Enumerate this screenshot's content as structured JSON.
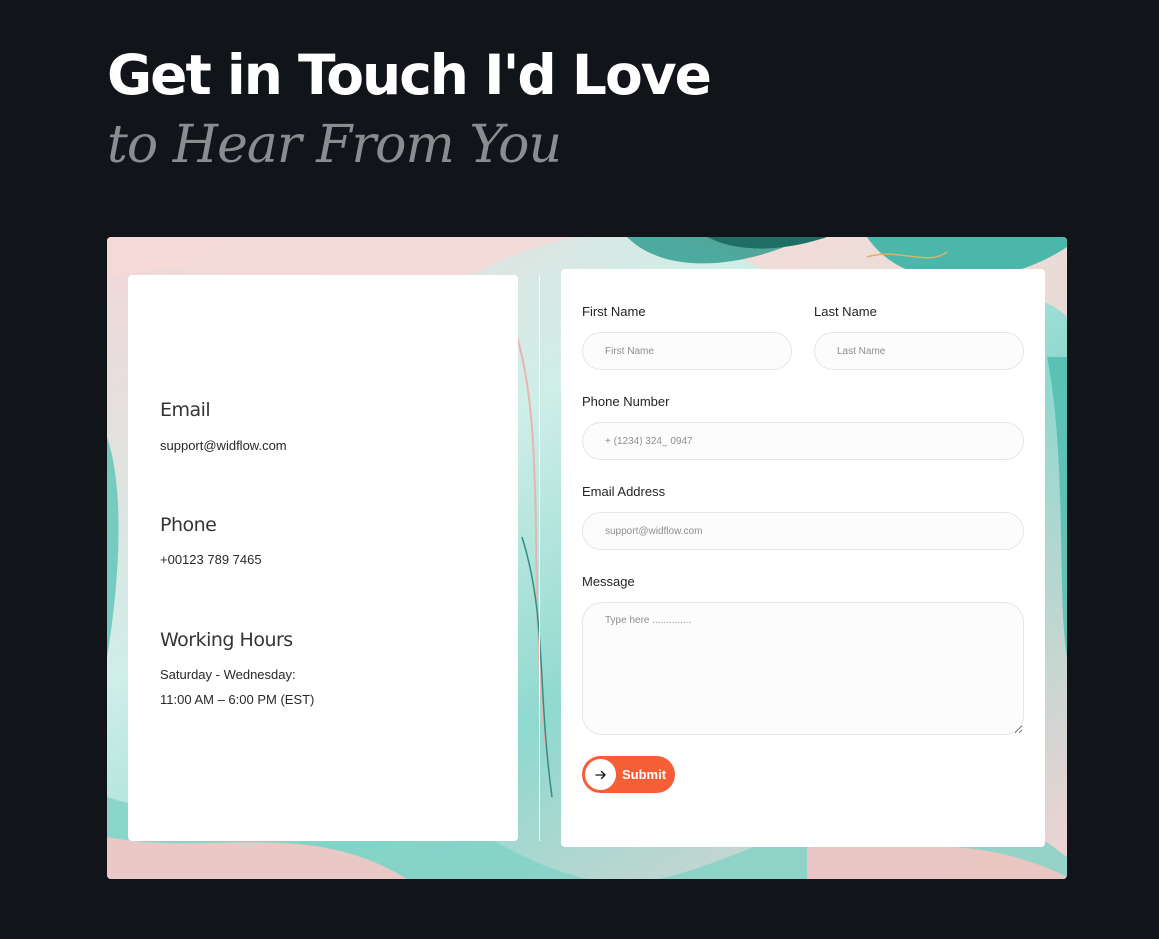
{
  "heading": {
    "line1": "Get in Touch I'd Love",
    "line2": "to Hear From You"
  },
  "contact": {
    "email_title": "Email",
    "email_value": "support@widflow.com",
    "phone_title": "Phone",
    "phone_value": "+00123 789 7465",
    "hours_title": "Working Hours",
    "hours_days": "Saturday - Wednesday:",
    "hours_time": "11:00 AM – 6:00 PM (EST)"
  },
  "form": {
    "first_name_label": "First Name",
    "first_name_placeholder": "First Name",
    "last_name_label": "Last Name",
    "last_name_placeholder": "Last Name",
    "phone_label": "Phone Number",
    "phone_placeholder": "+ (1234) 324_ 0947",
    "email_label": "Email Address",
    "email_placeholder": "support@widflow.com",
    "message_label": "Message",
    "message_placeholder": "Type here ..............",
    "submit_label": "Submit"
  },
  "colors": {
    "background": "#111419",
    "accent": "#f65f35",
    "card": "#ffffff"
  },
  "icons": {
    "submit": "arrow-right-icon"
  }
}
